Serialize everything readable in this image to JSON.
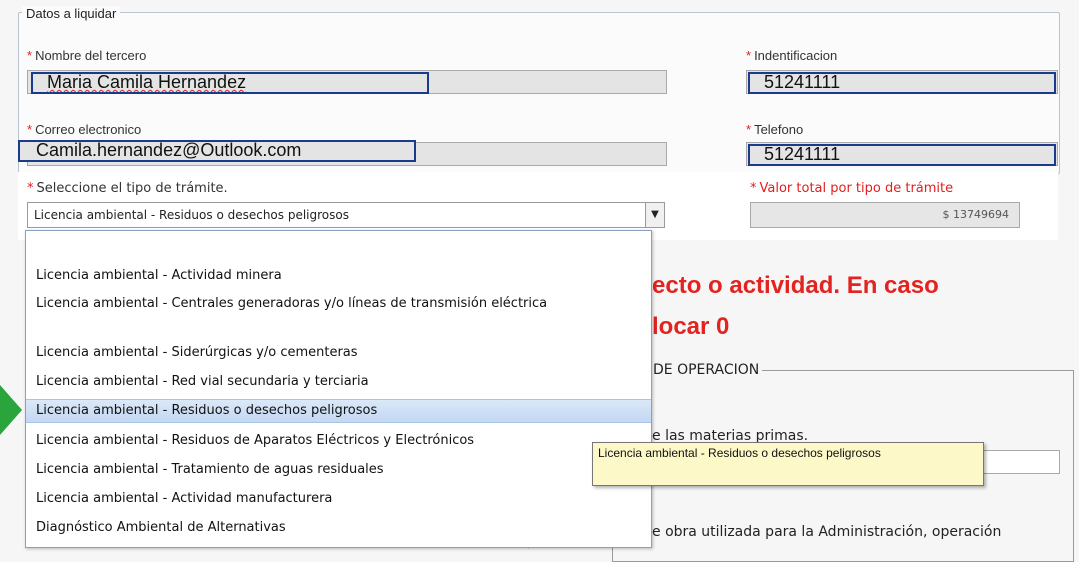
{
  "section": {
    "legend": "Datos a liquidar",
    "nombre": {
      "label": "Nombre del tercero",
      "value": "Maria Camila Hernandez"
    },
    "identificacion": {
      "label": "Indentificacion",
      "value": "51241111"
    },
    "correo": {
      "label": "Correo electronico",
      "value": "Camila.hernandez@Outlook.com"
    },
    "telefono": {
      "label": "Telefono",
      "value": "51241111"
    }
  },
  "tramite": {
    "label": "Seleccione el tipo de trámite.",
    "selected": "Licencia ambiental - Residuos o desechos peligrosos",
    "arrow": "chevron-down-icon",
    "valor_label": "Valor total por tipo de trámite",
    "valor": "$ 13749694",
    "options": [
      "Licencia ambiental - Actividad minera",
      "Licencia ambiental - Centrales generadoras y/o líneas de transmisión eléctrica",
      "Licencia ambiental - Siderúrgicas y/o cementeras",
      "Licencia ambiental - Red vial secundaria y terciaria",
      "Licencia ambiental - Residuos o desechos peligrosos",
      "Licencia ambiental - Residuos de Aparatos Eléctricos y Electrónicos",
      "Licencia ambiental - Tratamiento de aguas residuales",
      "Licencia ambiental - Actividad manufacturera",
      "Diagnóstico Ambiental de Alternativas"
    ],
    "highlighted_index": 4,
    "tooltip": "Licencia ambiental - Residuos o desechos peligrosos"
  },
  "background": {
    "heading_line1": "ecto o actividad. En caso",
    "heading_line2": "locar 0",
    "fieldset_legend": "DE OPERACION",
    "text1": "e las materias primas.",
    "text2": "e obra utilizada para la Administración, operación"
  },
  "colors": {
    "required": "#e02020",
    "heading": "#e3231f",
    "arrow": "#2aa43c"
  }
}
